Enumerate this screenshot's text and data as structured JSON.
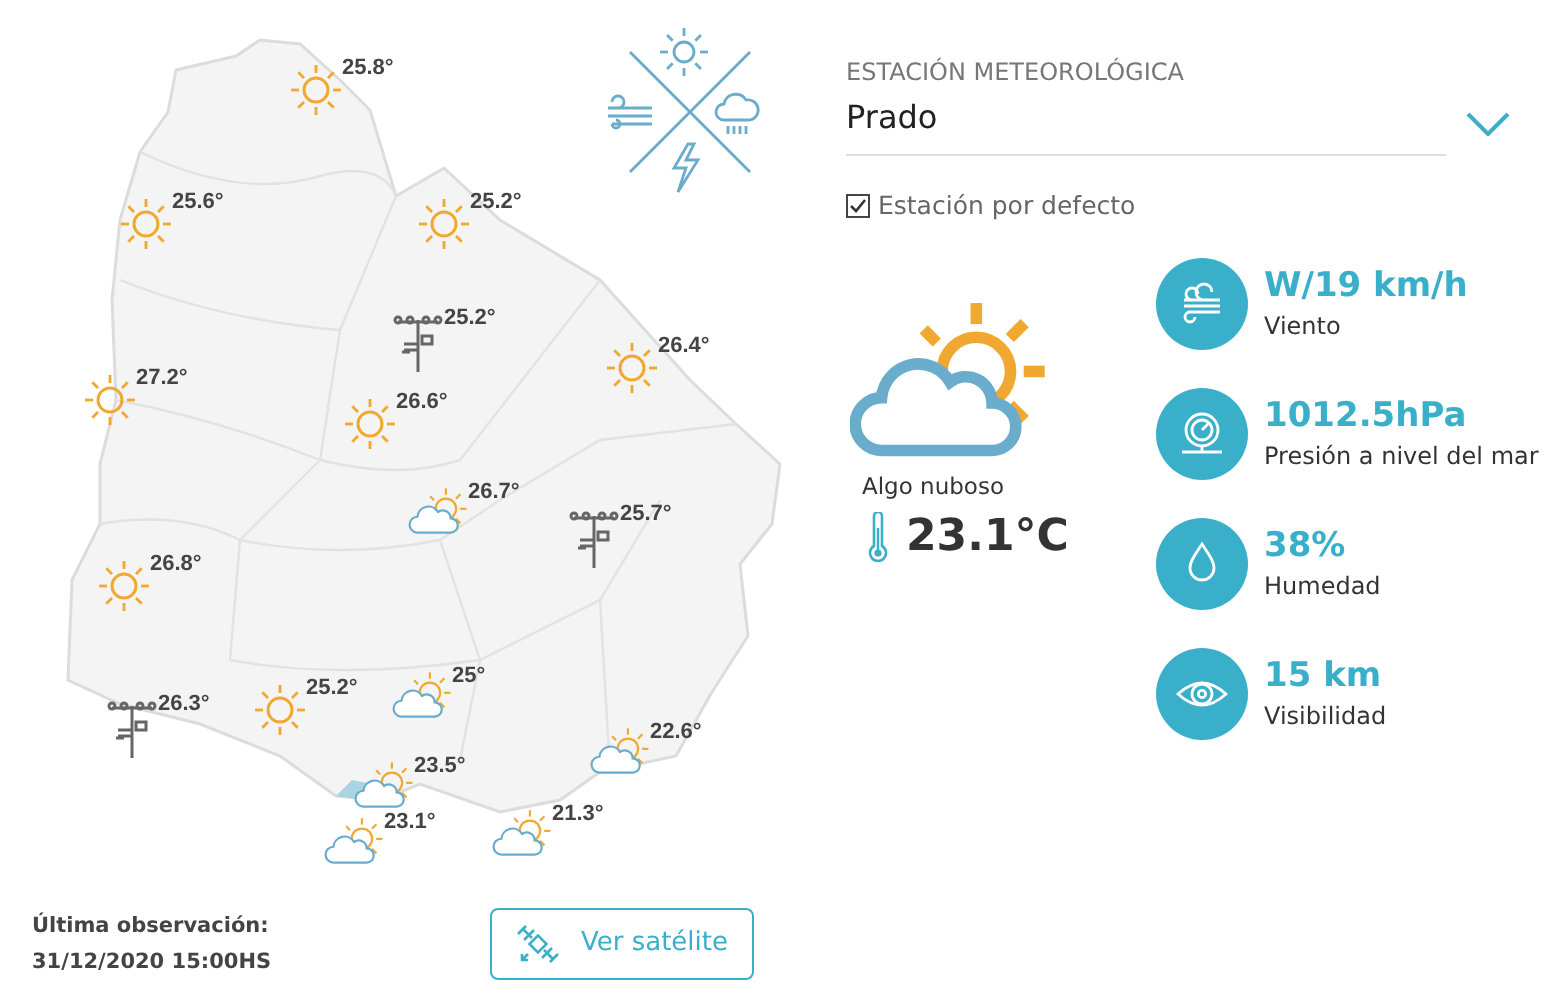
{
  "station_select": {
    "label": "ESTACIÓN METEOROLÓGICA",
    "value": "Prado"
  },
  "default_station": {
    "label": "Estación por defecto",
    "checked": true
  },
  "current": {
    "kind": "partly",
    "condition": "Algo nuboso",
    "temperature": "23.1°C"
  },
  "stats": [
    {
      "kind": "wind",
      "value": "W/19 km/h",
      "label": "Viento"
    },
    {
      "kind": "pressure",
      "value": "1012.5hPa",
      "label": "Presión a nivel del mar"
    },
    {
      "kind": "humidity",
      "value": "38%",
      "label": "Humedad"
    },
    {
      "kind": "visibility",
      "value": "15 km",
      "label": "Visibilidad"
    }
  ],
  "map_markers": [
    {
      "kind": "sun",
      "temp": "25.8°"
    },
    {
      "kind": "sun",
      "temp": "25.6°"
    },
    {
      "kind": "sun",
      "temp": "25.2°"
    },
    {
      "kind": "station",
      "temp": "25.2°"
    },
    {
      "kind": "sun",
      "temp": "26.4°"
    },
    {
      "kind": "sun",
      "temp": "27.2°"
    },
    {
      "kind": "sun",
      "temp": "26.6°"
    },
    {
      "kind": "partly",
      "temp": "26.7°"
    },
    {
      "kind": "station",
      "temp": "25.7°"
    },
    {
      "kind": "sun",
      "temp": "26.8°"
    },
    {
      "kind": "station",
      "temp": "26.3°"
    },
    {
      "kind": "sun",
      "temp": "25.2°"
    },
    {
      "kind": "partly",
      "temp": "25°"
    },
    {
      "kind": "partly",
      "temp": "22.6°"
    },
    {
      "kind": "partly",
      "temp": "23.5°"
    },
    {
      "kind": "partly",
      "temp": "23.1°"
    },
    {
      "kind": "partly",
      "temp": "21.3°"
    }
  ],
  "last_observation": {
    "label": "Última observación:",
    "value": "31/12/2020 15:00HS"
  },
  "satellite_button": {
    "label": "Ver satélite"
  }
}
